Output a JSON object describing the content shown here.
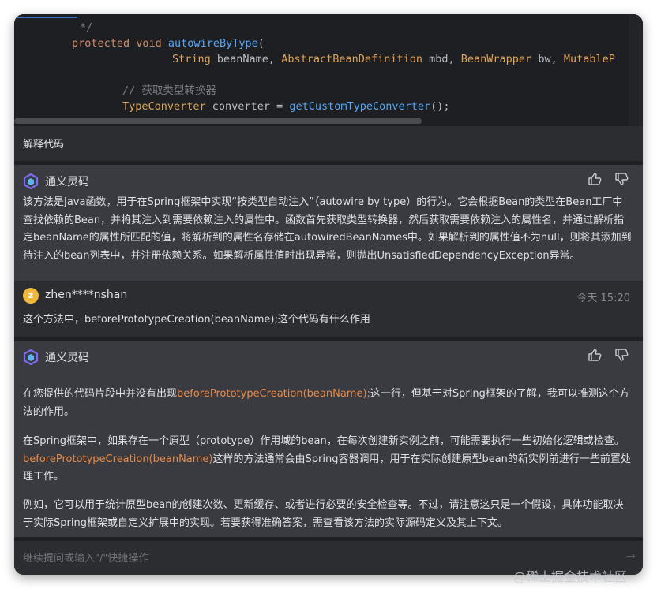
{
  "code": {
    "lines": [
      {
        "segments": [
          {
            "t": "*/",
            "c": "c-com"
          }
        ]
      },
      {
        "segments": [
          {
            "t": "protected ",
            "c": "c-kw"
          },
          {
            "t": "void ",
            "c": "c-kw"
          },
          {
            "t": "autowireByType",
            "c": "c-fn"
          },
          {
            "t": "(",
            "c": "c-id"
          }
        ]
      },
      {
        "segments": [
          {
            "t": "String ",
            "c": "c-ty"
          },
          {
            "t": "beanName, ",
            "c": "c-id"
          },
          {
            "t": "AbstractBeanDefinition ",
            "c": "c-ty"
          },
          {
            "t": "mbd, ",
            "c": "c-id"
          },
          {
            "t": "BeanWrapper ",
            "c": "c-ty"
          },
          {
            "t": "bw, ",
            "c": "c-id"
          },
          {
            "t": "MutableP",
            "c": "c-ty"
          }
        ]
      },
      {
        "segments": []
      },
      {
        "segments": [
          {
            "t": "// 获取类型转换器",
            "c": "c-com"
          }
        ]
      },
      {
        "segments": [
          {
            "t": "TypeConverter ",
            "c": "c-ty"
          },
          {
            "t": "converter = ",
            "c": "c-id"
          },
          {
            "t": "getCustomTypeConverter",
            "c": "c-fn"
          },
          {
            "t": "();",
            "c": "c-id"
          }
        ]
      }
    ]
  },
  "prompt_label": "解释代码",
  "assistant_name": "通义灵码",
  "response1": "该方法是Java函数，用于在Spring框架中实现“按类型自动注入”（autowire by type）的行为。它会根据Bean的类型在Bean工厂中查找依赖的Bean，并将其注入到需要依赖注入的属性中。函数首先获取类型转换器，然后获取需要依赖注入的属性名，并通过解析指定beanName的属性所匹配的值，将解析到的属性名存储在autowiredBeanNames中。如果解析到的属性值不为null，则将其添加到待注入的bean列表中，并注册依赖关系。如果解析属性值时出现异常，则抛出UnsatisfiedDependencyException异常。",
  "user": {
    "avatar_letter": "z",
    "name": "zhen****nshan",
    "time": "今天 15:20",
    "message": "这个方法中，beforePrototypeCreation(beanName);这个代码有什么作用"
  },
  "response2": {
    "p1_pre": "在您提供的代码片段中并没有出现",
    "p1_hl": "beforePrototypeCreation(beanName);",
    "p1_post": "这一行，但基于对Spring框架的了解，我可以推测这个方法的作用。",
    "p2_pre": "在Spring框架中，如果存在一个原型（prototype）作用域的bean，在每次创建新实例之前，可能需要执行一些初始化逻辑或检查。",
    "p2_hl": "beforePrototypeCreation(beanName)",
    "p2_post": "这样的方法通常会由Spring容器调用，用于在实际创建原型bean的新实例前进行一些前置处理工作。",
    "p3": "例如，它可以用于统计原型bean的创建次数、更新缓存、或者进行必要的安全检查等。不过，请注意这只是一个假设，具体功能取决于实际Spring框架或自定义扩展中的实现。若要获得准确答案，需查看该方法的实际源码定义及其上下文。"
  },
  "input_placeholder": "继续提问或输入\"/\"快捷操作",
  "watermark": "@稀土掘金技术社区",
  "colors": {
    "accent": "#3f72c4",
    "highlight": "#e88a4a",
    "card_bg": "#393b40",
    "panel_bg": "#2b2d30"
  }
}
